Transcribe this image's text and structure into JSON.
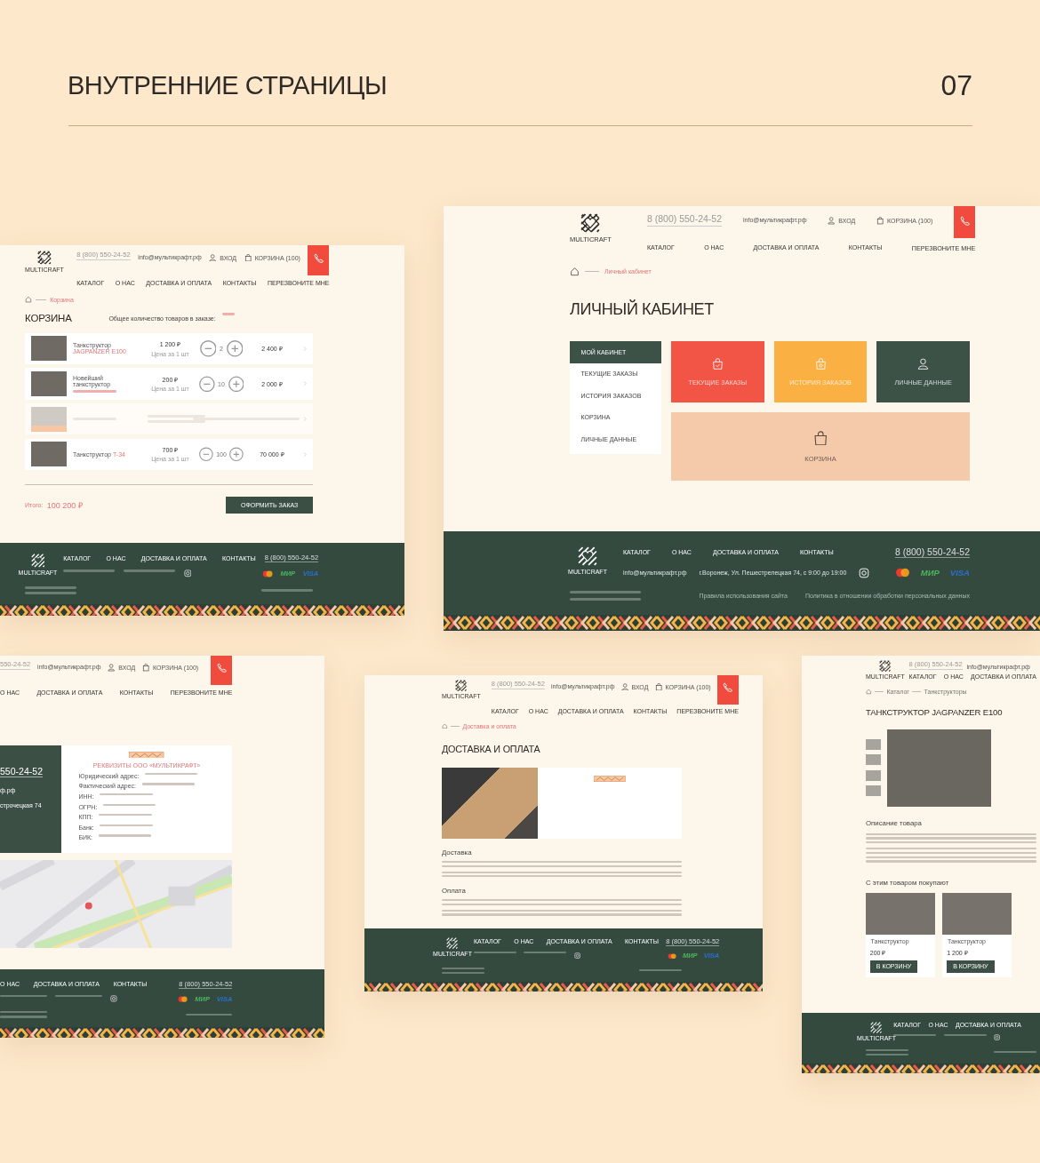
{
  "heading": {
    "title": "ВНУТРЕННИЕ СТРАНИЦЫ",
    "number": "07"
  },
  "mockups": [
    {
      "kind": "cart",
      "header": {
        "logo": "MULTICRAFT",
        "phone": "8 (800) 550-24-52",
        "email": "info@мультикрафт.рф",
        "login": "ВХОД",
        "cart": "КОРЗИНА (100)",
        "nav": [
          "КАТАЛОГ",
          "О НАС",
          "ДОСТАВКА И ОПЛАТА",
          "КОНТАКТЫ"
        ],
        "callback": "ПЕРЕЗВОНИТЕ МНЕ"
      },
      "breadcrumb": [
        {
          "label": "Корзина",
          "current": true
        }
      ],
      "title": "КОРЗИНА",
      "note": "Общее количество товаров в заказе:",
      "rows": [
        {
          "name": "Танкструктор",
          "link": "JAGPANZER E100",
          "price": "1 200 ₽",
          "price_note": "Цена за 1 шт",
          "quantity": "2",
          "total": "2 400 ₽",
          "disabled": false
        },
        {
          "name": "Новейший танкструктор",
          "price": "200 ₽",
          "price_note": "Цена за 1 шт",
          "quantity": "10",
          "total": "2 000 ₽",
          "disabled": false
        },
        {
          "disabled": true
        },
        {
          "name": "Танкструктор",
          "link": "T-34",
          "price": "700 ₽",
          "price_note": "Цена за 1 шт",
          "quantity": "100",
          "total": "70 000 ₽",
          "disabled": false
        }
      ],
      "total_label": "Итого:",
      "total": "100 200 ₽",
      "checkout": "ОФОРМИТЬ ЗАКАЗ",
      "footer": {
        "logo": "MULTICRAFT",
        "nav": [
          "КАТАЛОГ",
          "О НАС",
          "ДОСТАВКА И ОПЛАТА",
          "КОНТАКТЫ"
        ],
        "phone": "8 (800) 550-24-52",
        "payments": [
          "МИР",
          "VISA"
        ]
      }
    },
    {
      "kind": "cabinet",
      "header": {
        "logo": "MULTICRAFT",
        "phone": "8 (800) 550-24-52",
        "email": "info@мультикрафт.рф",
        "login": "ВХОД",
        "cart": "КОРЗИНА (100)",
        "nav": [
          "КАТАЛОГ",
          "О НАС",
          "ДОСТАВКА И ОПЛАТА",
          "КОНТАКТЫ"
        ],
        "callback": "ПЕРЕЗВОНИТЕ МНЕ"
      },
      "breadcrumb": [
        {
          "label": "Личный кабинет",
          "current": true
        }
      ],
      "title": "ЛИЧНЫЙ КАБИНЕТ",
      "menu": [
        {
          "label": "МОЙ КАБИНЕТ",
          "selected": true
        },
        {
          "label": "ТЕКУЩИЕ ЗАКАЗЫ",
          "selected": false
        },
        {
          "label": "ИСТОРИЯ ЗАКАЗОВ",
          "selected": false
        },
        {
          "label": "КОРЗИНА",
          "selected": false
        },
        {
          "label": "ЛИЧНЫЕ ДАННЫЕ",
          "selected": false
        }
      ],
      "tiles": [
        {
          "kind": "orders",
          "label": "ТЕКУЩИЕ ЗАКАЗЫ",
          "color": "#f25545"
        },
        {
          "kind": "history",
          "label": "ИСТОРИЯ ЗАКАЗОВ",
          "color": "#fbb044"
        },
        {
          "kind": "profile",
          "label": "ЛИЧНЫЕ ДАННЫЕ",
          "color": "#3d5246"
        },
        {
          "kind": "cart",
          "label": "КОРЗИНА",
          "color": "#f5caab"
        }
      ],
      "footer": {
        "logo": "MULTICRAFT",
        "nav": [
          "КАТАЛОГ",
          "О НАС",
          "ДОСТАВКА И ОПЛАТА",
          "КОНТАКТЫ"
        ],
        "phone": "8 (800) 550-24-52",
        "email": "info@мультикрафт.рф",
        "address": "г.Воронеж, Ул. Пешестрелецкая 74, с 9:00 до 19:00",
        "payments": [
          "МИР",
          "VISA"
        ],
        "legal": [
          "Правила использования сайта",
          "Политика в отношении обработки персональных данных"
        ]
      }
    },
    {
      "kind": "contacts",
      "header": {
        "phone": "550-24-52",
        "email": "info@мультикрафт.рф",
        "login": "ВХОД",
        "cart": "КОРЗИНА (100)",
        "nav": [
          "О НАС",
          "ДОСТАВКА И ОПЛАТА",
          "КОНТАКТЫ"
        ],
        "callback": "ПЕРЕЗВОНИТЕ МНЕ"
      },
      "panel": [
        "550-24-52",
        "ф.рф",
        "строчецкая 74"
      ],
      "details_title": "РЕКВИЗИТЫ ООО «МУЛЬТИКРАФТ»",
      "details": [
        "Юридический адрес:",
        "Фактический адрес:",
        "ИНН:",
        "ОГРН:",
        "КПП:",
        "Банк:",
        "БИК:"
      ],
      "footer": {
        "nav": [
          "О НАС",
          "ДОСТАВКА И ОПЛАТА",
          "КОНТАКТЫ"
        ],
        "phone": "8 (800) 550-24-52",
        "payments": [
          "МИР",
          "VISA"
        ]
      }
    },
    {
      "kind": "delivery",
      "header": {
        "logo": "MULTICRAFT",
        "phone": "8 (800) 550-24-52",
        "email": "info@мультикрафт.рф",
        "login": "ВХОД",
        "cart": "КОРЗИНА (100)",
        "nav": [
          "КАТАЛОГ",
          "О НАС",
          "ДОСТАВКА И ОПЛАТА",
          "КОНТАКТЫ"
        ],
        "callback": "ПЕРЕЗВОНИТЕ МНЕ"
      },
      "breadcrumb": [
        {
          "label": "Доставка и оплата",
          "current": true
        }
      ],
      "title": "ДОСТАВКА И ОПЛАТА",
      "sections": [
        "Доставка",
        "Оплата"
      ],
      "footer": {
        "logo": "MULTICRAFT",
        "nav": [
          "КАТАЛОГ",
          "О НАС",
          "ДОСТАВКА И ОПЛАТА",
          "КОНТАКТЫ"
        ],
        "phone": "8 (800) 550-24-52",
        "payments": [
          "МИР",
          "VISA"
        ]
      }
    },
    {
      "kind": "product",
      "header": {
        "logo": "MULTICRAFT",
        "phone": "8 (800) 550-24-52",
        "email": "info@мультикрафт.рф",
        "nav": [
          "КАТАЛОГ",
          "О НАС",
          "ДОСТАВКА И ОПЛАТА"
        ]
      },
      "breadcrumb": [
        {
          "label": "Каталог",
          "current": false
        },
        {
          "label": "Танкструкторы",
          "current": false
        }
      ],
      "title": "ТАНКСТРУКТОР JAGPANZER E100",
      "description_title": "Описание товара",
      "related_title": "С этим товаром покупают",
      "related": [
        {
          "name": "Танкструктор",
          "price": "200 ₽",
          "button": "В КОРЗИНУ"
        },
        {
          "name": "Танкструктор",
          "price": "1 200 ₽",
          "button": "В КОРЗИНУ"
        }
      ],
      "footer": {
        "logo": "MULTICRAFT",
        "nav": [
          "КАТАЛОГ",
          "О НАС",
          "ДОСТАВКА И ОПЛАТА"
        ]
      }
    }
  ]
}
